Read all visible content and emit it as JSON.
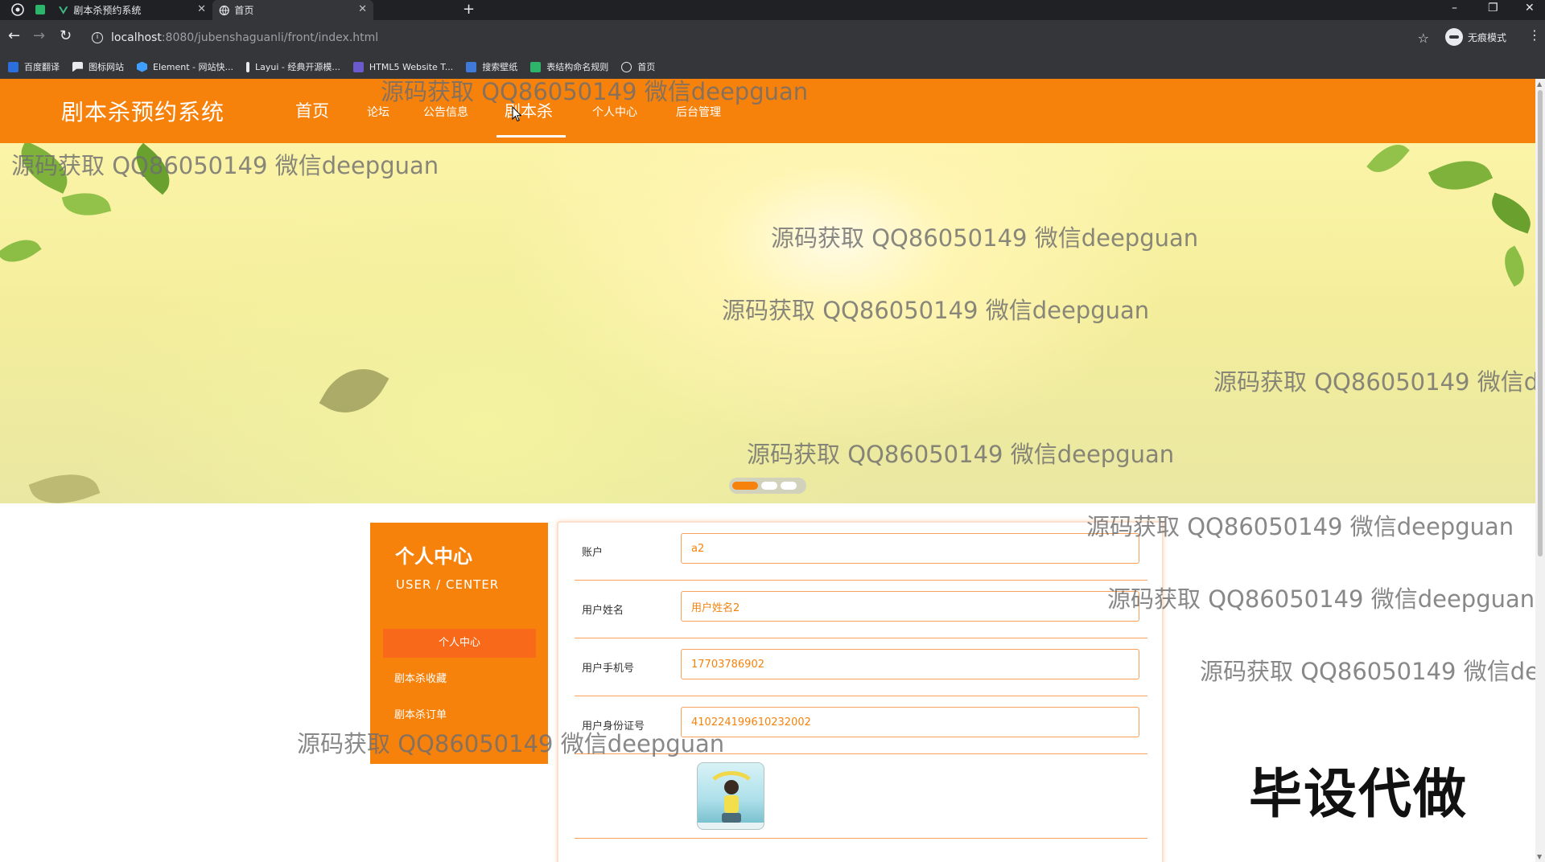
{
  "browser": {
    "tabs": [
      {
        "title": "剧本杀预约系统",
        "active": false
      },
      {
        "title": "首页",
        "active": true
      }
    ],
    "new_tab": "+",
    "url_host": "localhost",
    "url_path": ":8080/jubenshaguanli/front/index.html",
    "profile_label": "无痕模式",
    "bookmarks": [
      {
        "label": "百度翻译",
        "color": "#2a6fdb"
      },
      {
        "label": "图标网站",
        "color": "#e8eaed"
      },
      {
        "label": "Element - 网站快...",
        "color": "#409eff"
      },
      {
        "label": "Layui - 经典开源模...",
        "color": "#e8eaed"
      },
      {
        "label": "HTML5 Website T...",
        "color": "#6a5acd"
      },
      {
        "label": "搜索壁纸",
        "color": "#3f7ad9"
      },
      {
        "label": "表结构命名规则",
        "color": "#2cb56b"
      },
      {
        "label": "首页",
        "color": "#e8eaed"
      }
    ]
  },
  "site": {
    "title": "剧本杀预约系统",
    "nav": [
      {
        "label": "首页",
        "active": false
      },
      {
        "label": "论坛",
        "active": false
      },
      {
        "label": "公告信息",
        "active": false
      },
      {
        "label": "剧本杀",
        "active": true
      },
      {
        "label": "个人中心",
        "active": false
      },
      {
        "label": "后台管理",
        "active": false
      }
    ],
    "accent": "#f6820c"
  },
  "banner": {
    "carousel": {
      "slides": 3,
      "active": 1
    }
  },
  "user_center": {
    "title": "个人中心",
    "subtitle": "USER / CENTER",
    "menu": [
      {
        "label": "个人中心",
        "active": true
      },
      {
        "label": "剧本杀收藏",
        "active": false
      },
      {
        "label": "剧本杀订单",
        "active": false
      }
    ]
  },
  "profile_form": {
    "fields": [
      {
        "label": "账户",
        "value": "a2"
      },
      {
        "label": "用户姓名",
        "value": "用户姓名2"
      },
      {
        "label": "用户手机号",
        "value": "17703786902"
      },
      {
        "label": "用户身份证号",
        "value": "410224199610232002"
      }
    ],
    "photo_icon": "avatar-photo"
  },
  "overlays": {
    "watermark_text": "源码获取 QQ86050149 微信deepguan",
    "watermark_clipped": "源码获取 QQ86050149 微信d",
    "watermark_clipped_2": "源码获取 QQ86050149 微信de",
    "stamp": "毕设代做"
  }
}
